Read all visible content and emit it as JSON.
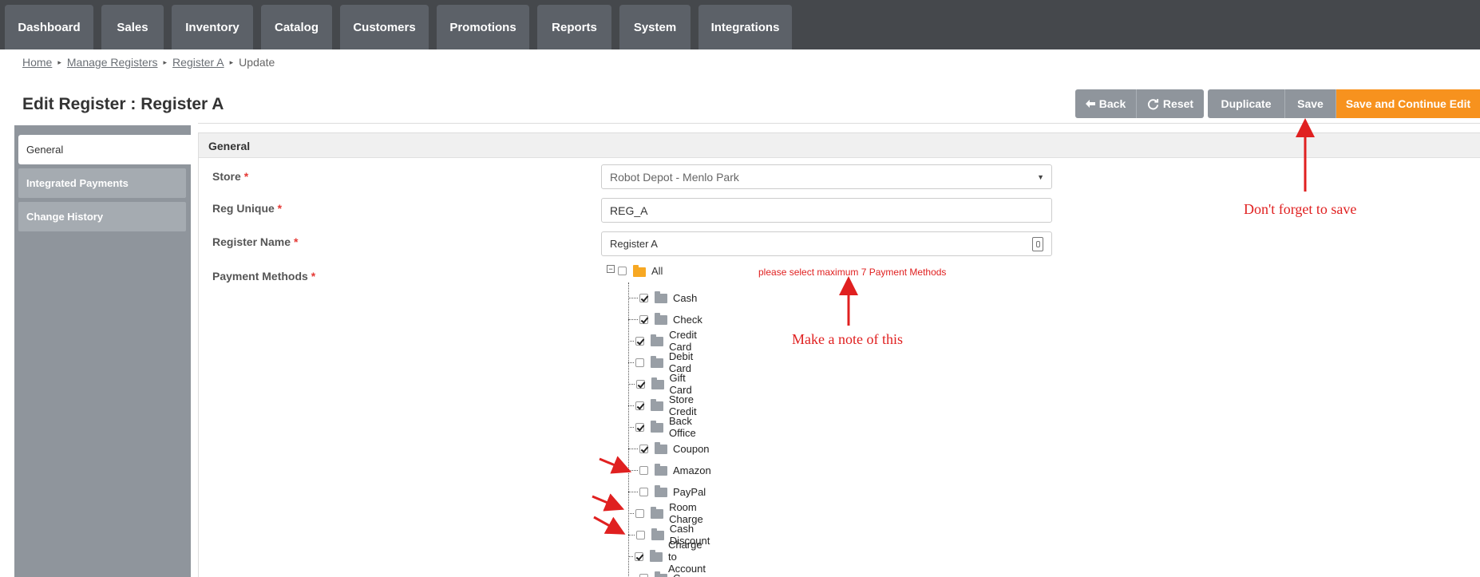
{
  "nav": {
    "tabs": [
      "Dashboard",
      "Sales",
      "Inventory",
      "Catalog",
      "Customers",
      "Promotions",
      "Reports",
      "System",
      "Integrations"
    ]
  },
  "breadcrumb": {
    "items": [
      "Home",
      "Manage Registers",
      "Register A"
    ],
    "current": "Update"
  },
  "page": {
    "title": "Edit Register : Register A"
  },
  "actions": {
    "back": "Back",
    "reset": "Reset",
    "duplicate": "Duplicate",
    "save": "Save",
    "save_continue": "Save and Continue Edit"
  },
  "sidebar": {
    "items": [
      {
        "label": "General",
        "active": true
      },
      {
        "label": "Integrated Payments",
        "active": false
      },
      {
        "label": "Change History",
        "active": false
      }
    ]
  },
  "panel": {
    "title": "General"
  },
  "form": {
    "store": {
      "label": "Store",
      "req": "*",
      "value": "Robot Depot - Menlo Park"
    },
    "reg_unique": {
      "label": "Reg Unique",
      "req": "*",
      "value": "REG_A"
    },
    "register_name": {
      "label": "Register Name",
      "req": "*",
      "value": "Register A"
    },
    "payment_methods": {
      "label": "Payment Methods",
      "req": "*"
    }
  },
  "tree": {
    "root": {
      "toggle": "−",
      "label": "All",
      "checked": false
    },
    "items": [
      {
        "label": "Cash",
        "checked": true
      },
      {
        "label": "Check",
        "checked": true
      },
      {
        "label": "Credit Card",
        "checked": true
      },
      {
        "label": "Debit Card",
        "checked": false
      },
      {
        "label": "Gift Card",
        "checked": true
      },
      {
        "label": "Store Credit",
        "checked": true
      },
      {
        "label": "Back Office",
        "checked": true
      },
      {
        "label": "Coupon",
        "checked": true
      },
      {
        "label": "Amazon",
        "checked": false
      },
      {
        "label": "PayPal",
        "checked": false
      },
      {
        "label": "Room Charge",
        "checked": false
      },
      {
        "label": "Cash Discount",
        "checked": false
      },
      {
        "label": "Charge to Account",
        "checked": true
      },
      {
        "label": "C...",
        "checked": false
      }
    ]
  },
  "annotations": {
    "max_warning": "please select maximum 7 Payment Methods",
    "note_this": "Make a note of this",
    "save_reminder": "Don't forget to save"
  },
  "colors": {
    "topbar": "#45484c",
    "tab": "#5c6168",
    "accent": "#f7921e",
    "button": "#8f959c",
    "annotation": "#e02020"
  }
}
